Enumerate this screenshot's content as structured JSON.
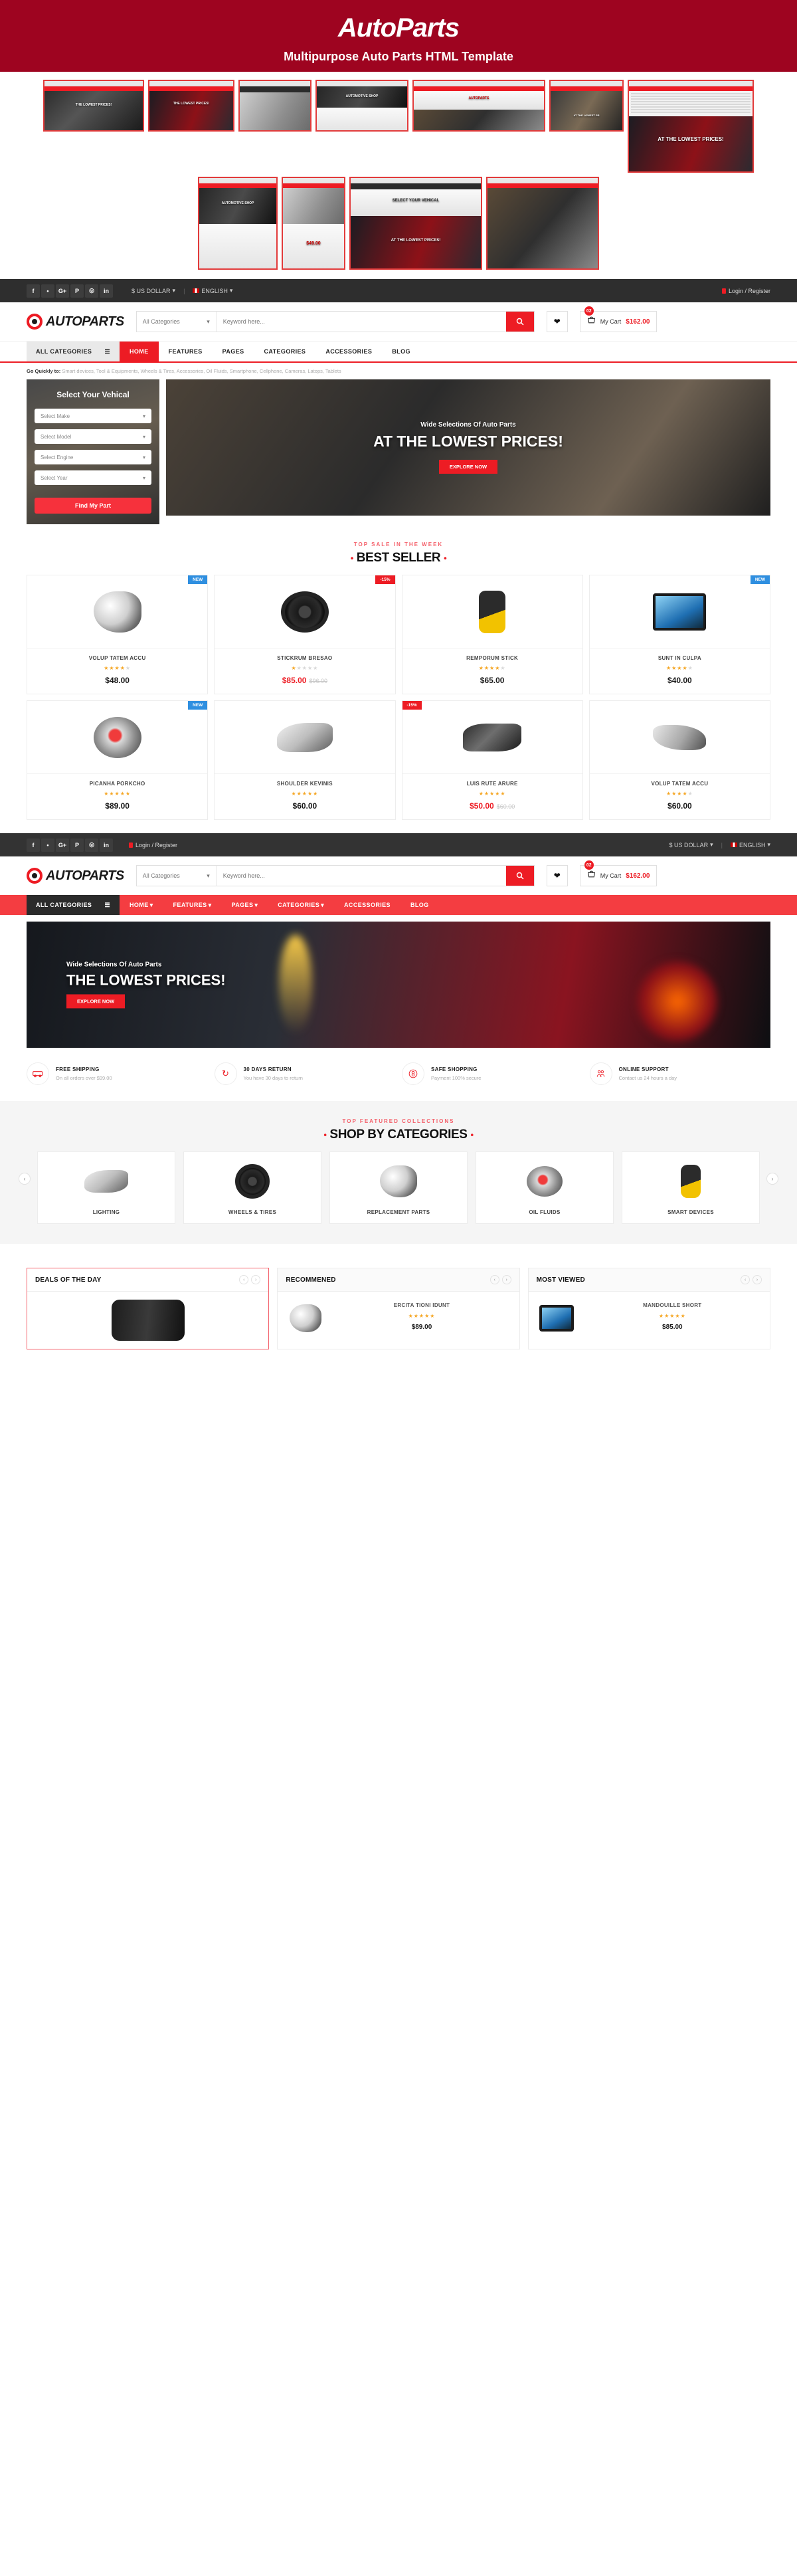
{
  "promo": {
    "title": "AutoParts",
    "subtitle": "Multipurpose Auto Parts HTML Template",
    "thumb_captions": [
      "THE LOWEST PRICES!",
      "THE LOWEST PRICES!",
      "AUTOMOTIVE SHOP",
      "AUTOPARTS",
      "AT THE LOWEST PR",
      "AT THE LOWEST PRICES!",
      "AUTOMOTIVE SHOP",
      "$49.00",
      "SELECT YOUR VEHICAL",
      "AT THE LOWEST PRICES!"
    ]
  },
  "topbar": {
    "socials": [
      "facebook-icon",
      "twitter-icon",
      "google-plus-icon",
      "pinterest-icon",
      "instagram-icon",
      "linkedin-icon"
    ],
    "social_glyphs": [
      "f",
      "ᵛ",
      "G+",
      "ᴘ",
      "◎",
      "in"
    ],
    "currency": "$ US DOLLAR",
    "language": "ENGLISH",
    "login": "Login / Register"
  },
  "header": {
    "logo_text": "AUTOPARTS",
    "category_select": "All Categories",
    "search_placeholder": "Keyword here...",
    "search_value": "",
    "cart_label": "My Cart",
    "cart_amount": "$162.00",
    "cart_count": "02"
  },
  "nav": {
    "all_categories": "ALL CATEGORIES",
    "items": [
      {
        "label": "HOME",
        "active": true,
        "caret": false
      },
      {
        "label": "FEATURES",
        "active": false,
        "caret": false
      },
      {
        "label": "PAGES",
        "active": false,
        "caret": false
      },
      {
        "label": "CATEGORIES",
        "active": false,
        "caret": false
      },
      {
        "label": "ACCESSORIES",
        "active": false,
        "caret": false
      },
      {
        "label": "BLOG",
        "active": false,
        "caret": false
      }
    ],
    "items_alt": [
      {
        "label": "HOME",
        "active": true,
        "caret": true
      },
      {
        "label": "FEATURES",
        "active": false,
        "caret": true
      },
      {
        "label": "PAGES",
        "active": false,
        "caret": true
      },
      {
        "label": "CATEGORIES",
        "active": false,
        "caret": true
      },
      {
        "label": "ACCESSORIES",
        "active": false,
        "caret": false
      },
      {
        "label": "BLOG",
        "active": false,
        "caret": false
      }
    ]
  },
  "quicklinks": {
    "label": "Go Quickly to:",
    "text": " Smart devices, Tool & Equipments, Wheels & Tires, Accessories, Oil Fluids, Smartphone, Cellphone, Cameras, Latops, Tablets"
  },
  "vehical": {
    "title": "Select Your Vehical",
    "selects": [
      "Select Make",
      "Select Model",
      "Select Engine",
      "Select Year"
    ],
    "button": "Find My Part"
  },
  "hero": {
    "subtitle": "Wide Selections Of Auto Parts",
    "title": "AT THE LOWEST PRICES!",
    "button": "EXPLORE NOW"
  },
  "hero2": {
    "subtitle": "Wide Selections Of Auto Parts",
    "title": "THE LOWEST PRICES!",
    "button": "EXPLORE NOW"
  },
  "bestseller": {
    "kicker": "TOP SALE IN THE WEEK",
    "title": "BEST SELLER",
    "products": [
      {
        "name": "VOLUP TATEM ACCU",
        "price": "$48.00",
        "old": "",
        "stars": 4,
        "tag": "NEW",
        "tag_type": "new",
        "art": "alt"
      },
      {
        "name": "STICKRUM BRESAO",
        "price": "$85.00",
        "old": "$96.00",
        "stars": 1,
        "tag": "-15%",
        "tag_type": "sale",
        "art": "wheel"
      },
      {
        "name": "REMPORUM STICK",
        "price": "$65.00",
        "old": "",
        "stars": 4,
        "tag": "",
        "tag_type": "",
        "art": "scan"
      },
      {
        "name": "SUNT IN CULPA",
        "price": "$40.00",
        "old": "",
        "stars": 4,
        "tag": "NEW",
        "tag_type": "new",
        "art": "mon"
      },
      {
        "name": "PICANHA PORKCHO",
        "price": "$89.00",
        "old": "",
        "stars": 5,
        "tag": "NEW",
        "tag_type": "new",
        "art": "turbo"
      },
      {
        "name": "SHOULDER KEVINIS",
        "price": "$60.00",
        "old": "",
        "stars": 5,
        "tag": "",
        "tag_type": "",
        "art": "lamp"
      },
      {
        "name": "LUIS RUTE ARURE",
        "price": "$50.00",
        "old": "$60.00",
        "stars": 5,
        "tag": "-15%",
        "tag_type": "sale-left",
        "art": "dual"
      },
      {
        "name": "VOLUP TATEM ACCU",
        "price": "$60.00",
        "old": "",
        "stars": 4,
        "tag": "",
        "tag_type": "",
        "art": "bulb"
      }
    ]
  },
  "services": [
    {
      "icon": "truck-icon",
      "glyph": "⛟",
      "title": "FREE SHIPPING",
      "sub": "On all orders over $99.00"
    },
    {
      "icon": "refresh-icon",
      "glyph": "↻",
      "title": "30 DAYS RETURN",
      "sub": "You have 30 days to return"
    },
    {
      "icon": "shield-icon",
      "glyph": "⚇",
      "title": "SAFE SHOPPING",
      "sub": "Payment 100% secure"
    },
    {
      "icon": "support-icon",
      "glyph": "☻",
      "title": "ONLINE SUPPORT",
      "sub": "Contact us 24 hours a day"
    }
  ],
  "categories": {
    "kicker": "TOP FEATURED COLLECTIONS",
    "title": "SHOP BY CATEGORIES",
    "items": [
      {
        "name": "LIGHTING",
        "art": "lamp"
      },
      {
        "name": "WHEELS & TIRES",
        "art": "wheel"
      },
      {
        "name": "REPLACEMENT PARTS",
        "art": "alt"
      },
      {
        "name": "OIL FLUIDS",
        "art": "turbo"
      },
      {
        "name": "SMART DEVICES",
        "art": "scan"
      }
    ],
    "prev": "‹",
    "next": "›"
  },
  "panels": [
    {
      "title": "DEALS OF THE DAY",
      "highlight": true,
      "product": null
    },
    {
      "title": "RECOMMENED",
      "highlight": false,
      "product": {
        "name": "ERCITA TIONI IDUNT",
        "stars": 5,
        "price": "$89.00"
      }
    },
    {
      "title": "MOST VIEWED",
      "highlight": false,
      "product": {
        "name": "MANDOUILLE SHORT",
        "stars": 5,
        "price": "$85.00"
      }
    }
  ],
  "panel_nav": {
    "prev": "‹",
    "next": "›"
  },
  "colors": {
    "brand_red": "#ed1c24",
    "promo_red": "#9e0420",
    "dark": "#2e2e2e",
    "star": "#f5a623"
  }
}
